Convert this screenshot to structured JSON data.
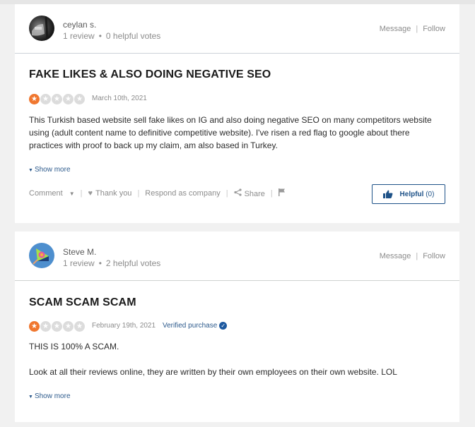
{
  "reviews": [
    {
      "user": {
        "name": "ceylan s.",
        "reviews": "1 review",
        "helpful_votes": "0 helpful votes",
        "avatar_icon": "user-photo-avatar"
      },
      "header_links": {
        "message": "Message",
        "follow": "Follow"
      },
      "title": "FAKE LIKES & ALSO DOING NEGATIVE SEO",
      "rating": 1,
      "rating_max": 5,
      "date": "March 10th, 2021",
      "body": "This Turkish based website sell fake likes on IG and also doing negative SEO on many competitors website using (adult content name to definitive competitive website). I've risen a red flag to google about there practices with proof to back up my claim, am also based in Turkey.",
      "show_more": "Show more",
      "actions": {
        "comment": "Comment",
        "thank_you": "Thank you",
        "respond": "Respond as company",
        "share": "Share"
      },
      "helpful": {
        "label": "Helpful",
        "count": "(0)"
      }
    },
    {
      "user": {
        "name": "Steve M.",
        "reviews": "1 review",
        "helpful_votes": "2 helpful votes",
        "avatar_icon": "user-logo-avatar"
      },
      "header_links": {
        "message": "Message",
        "follow": "Follow"
      },
      "title": "SCAM SCAM SCAM",
      "rating": 1,
      "rating_max": 5,
      "date": "February 19th, 2021",
      "verified": "Verified purchase",
      "body_lines": [
        "THIS IS 100% A SCAM.",
        "Look at all their reviews online, they are written by their own employees on their own website. LOL"
      ],
      "show_more": "Show more"
    }
  ],
  "colors": {
    "star_on": "#f0772f",
    "star_off": "#dcdcdc",
    "link_blue": "#2d5a8c",
    "helpful_border": "#1e5288"
  }
}
